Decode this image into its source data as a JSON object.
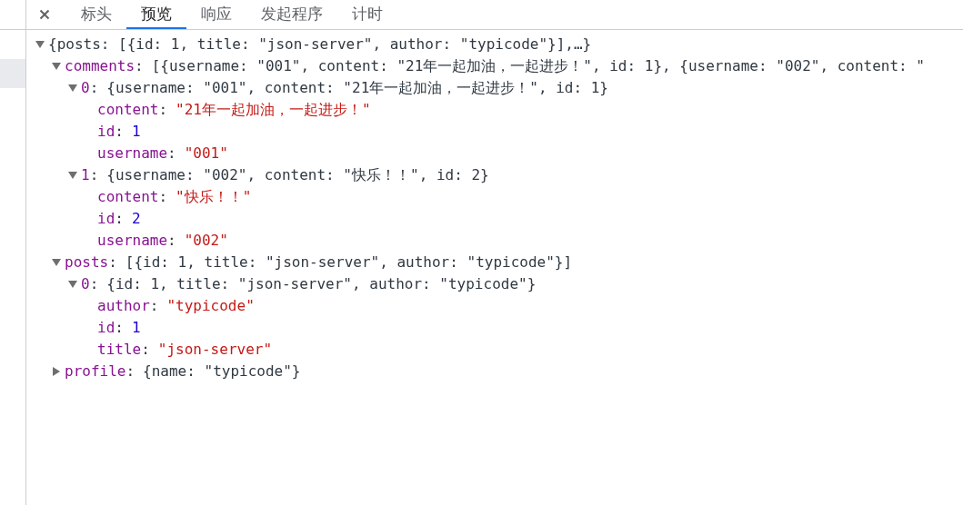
{
  "tabs": [
    {
      "label": "标头",
      "selected": false
    },
    {
      "label": "预览",
      "selected": true
    },
    {
      "label": "响应",
      "selected": false
    },
    {
      "label": "发起程序",
      "selected": false
    },
    {
      "label": "计时",
      "selected": false
    }
  ],
  "tree": {
    "summary": "{posts: [{id: 1, title: \"json-server\", author: \"typicode\"}],…}",
    "expanded": true,
    "children": [
      {
        "key": "comments:",
        "summary": "[{username: \"001\", content: \"21年一起加油，一起进步！\", id: 1}, {username: \"002\", content: \"",
        "expanded": true,
        "children": [
          {
            "key": "0:",
            "summary": "{username: \"001\", content: \"21年一起加油，一起进步！\", id: 1}",
            "expanded": true,
            "children": [
              {
                "key": "content:",
                "value": "\"21年一起加油，一起进步！\"",
                "kind": "string"
              },
              {
                "key": "id:",
                "value": "1",
                "kind": "number"
              },
              {
                "key": "username:",
                "value": "\"001\"",
                "kind": "string"
              }
            ]
          },
          {
            "key": "1:",
            "summary": "{username: \"002\", content: \"快乐！！\", id: 2}",
            "expanded": true,
            "children": [
              {
                "key": "content:",
                "value": "\"快乐！！\"",
                "kind": "string"
              },
              {
                "key": "id:",
                "value": "2",
                "kind": "number"
              },
              {
                "key": "username:",
                "value": "\"002\"",
                "kind": "string"
              }
            ]
          }
        ]
      },
      {
        "key": "posts:",
        "summary": "[{id: 1, title: \"json-server\", author: \"typicode\"}]",
        "expanded": true,
        "children": [
          {
            "key": "0:",
            "summary": "{id: 1, title: \"json-server\", author: \"typicode\"}",
            "expanded": true,
            "children": [
              {
                "key": "author:",
                "value": "\"typicode\"",
                "kind": "string"
              },
              {
                "key": "id:",
                "value": "1",
                "kind": "number"
              },
              {
                "key": "title:",
                "value": "\"json-server\"",
                "kind": "string"
              }
            ]
          }
        ]
      },
      {
        "key": "profile:",
        "summary": "{name: \"typicode\"}",
        "expanded": false
      }
    ]
  }
}
